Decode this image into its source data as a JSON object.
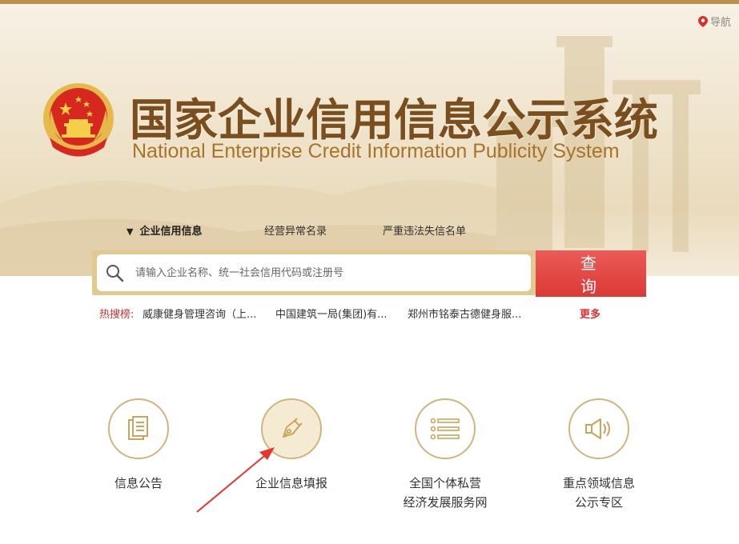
{
  "header": {
    "nav_label": "导航",
    "title_cn": "国家企业信用信息公示系统",
    "title_en": "National Enterprise Credit Information Publicity System"
  },
  "tabs": [
    {
      "label": "企业信用信息",
      "active": true
    },
    {
      "label": "经营异常名录",
      "active": false
    },
    {
      "label": "严重违法失信名单",
      "active": false
    }
  ],
  "search": {
    "placeholder": "请输入企业名称、统一社会信用代码或注册号",
    "button_label": "查 询"
  },
  "hot_search": {
    "label": "热搜榜:",
    "items": [
      "威康健身管理咨询（上...",
      "中国建筑一局(集团)有...",
      "郑州市铭泰古德健身服..."
    ],
    "more_label": "更多"
  },
  "services": [
    {
      "label_lines": [
        "信息公告"
      ],
      "icon": "document-icon"
    },
    {
      "label_lines": [
        "企业信息填报"
      ],
      "icon": "pen-nib-icon"
    },
    {
      "label_lines": [
        "全国个体私营",
        "经济发展服务网"
      ],
      "icon": "list-icon"
    },
    {
      "label_lines": [
        "重点领域信息",
        "公示专区"
      ],
      "icon": "speaker-icon"
    }
  ],
  "colors": {
    "brand_gold": "#b8924a",
    "title_brown": "#7a4f1d",
    "button_red": "#db3a36",
    "hot_red": "#d6322e"
  }
}
